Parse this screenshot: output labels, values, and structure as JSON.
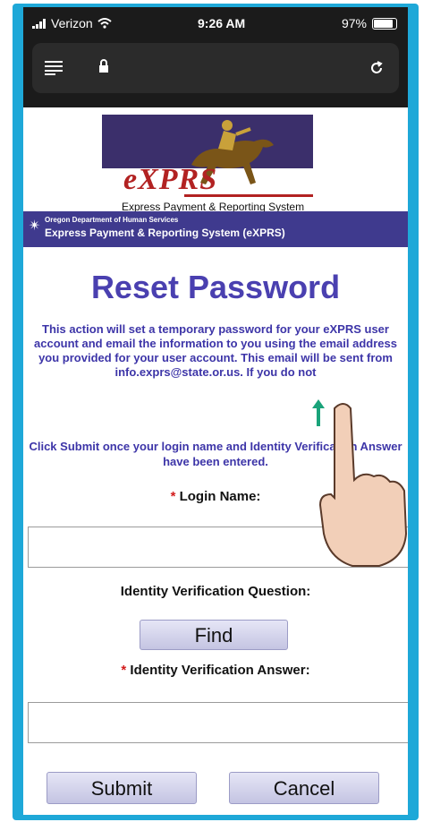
{
  "status_bar": {
    "carrier": "Verizon",
    "time": "9:26 AM",
    "battery": "97%",
    "battery_level": 0.97
  },
  "browser": {
    "menu_icon": "hamburger-icon",
    "lock_icon": "lock-icon",
    "reload_icon": "reload-icon"
  },
  "header": {
    "logo_text": "eXPRS",
    "tagline": "Express Payment & Reporting System",
    "dept": "Oregon Department of Human Services",
    "system_name": "Express Payment & Reporting System (eXPRS)"
  },
  "page": {
    "title": "Reset Password",
    "intro": "This action will set a temporary password for your eXPRS user account and email the information to you using the email address you provided for your user account. This email will be sent from info.exprs@state.or.us. If you do not",
    "instruction": "Click Submit once your login name and Identity Verification Answer have been entered."
  },
  "form": {
    "login_label": "Login Name:",
    "login_value": "",
    "question_label": "Identity Verification Question:",
    "find_label": "Find",
    "answer_label": "Identity Verification Answer:",
    "answer_value": "",
    "required_marker": "*"
  },
  "actions": {
    "submit_label": "Submit",
    "cancel_label": "Cancel"
  },
  "colors": {
    "frame": "#1ea8d8",
    "heading": "#4a40b0",
    "banner": "#3f3a8e",
    "required": "#d21c1c",
    "logo_red": "#b22222"
  }
}
